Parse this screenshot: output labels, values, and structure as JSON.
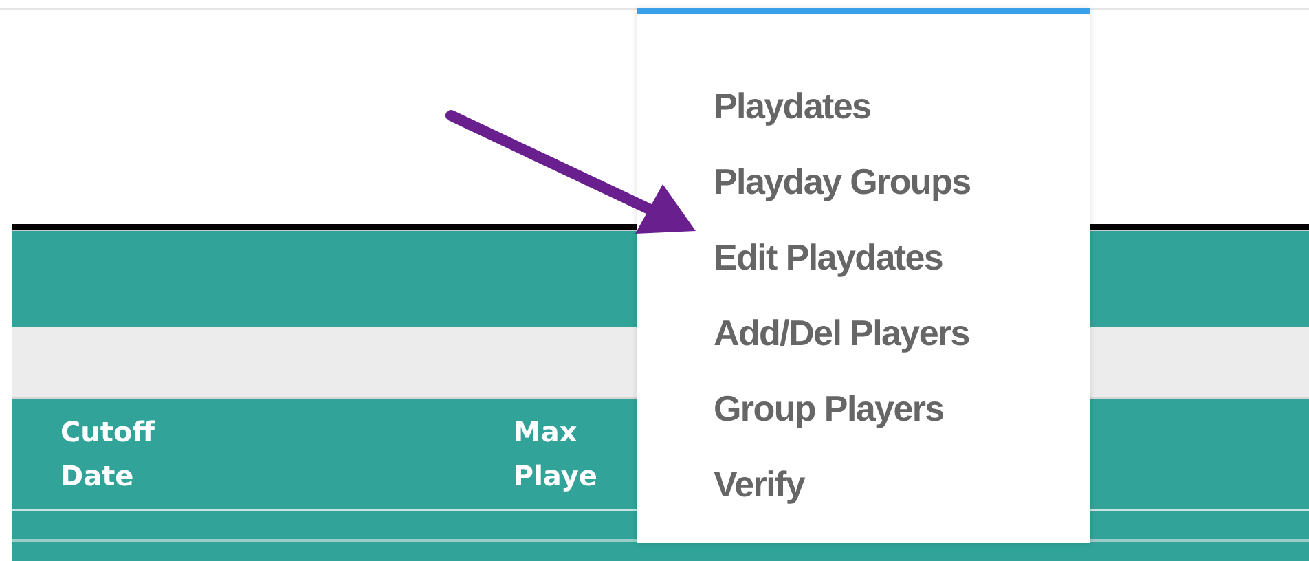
{
  "table_header": {
    "columns": [
      "Cutoff Date",
      "Max Playe"
    ]
  },
  "dropdown_menu": {
    "items": [
      {
        "label": "Playdates"
      },
      {
        "label": "Playday Groups"
      },
      {
        "label": "Edit Playdates"
      },
      {
        "label": "Add/Del Players"
      },
      {
        "label": "Group Players"
      },
      {
        "label": "Verify"
      }
    ]
  }
}
